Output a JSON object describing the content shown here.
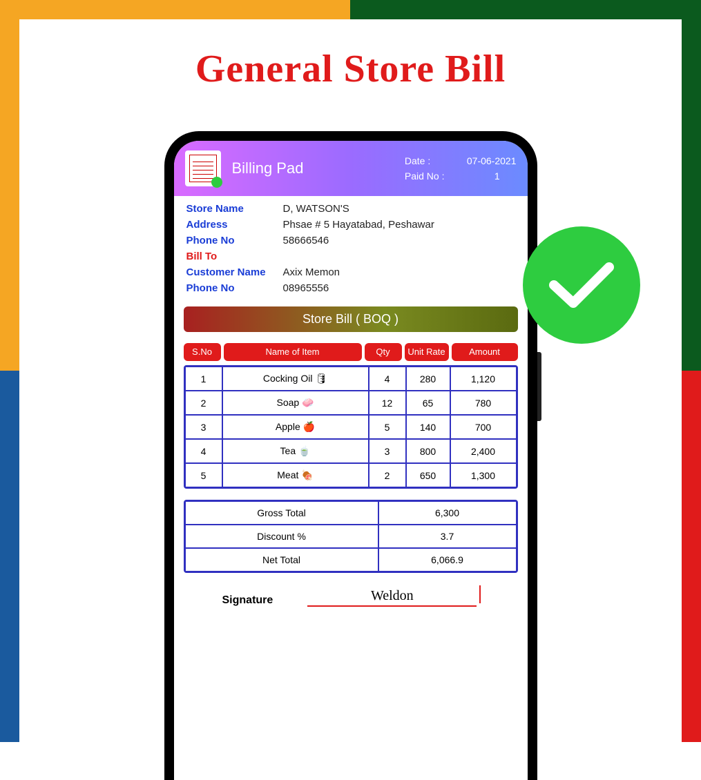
{
  "title": "General Store Bill",
  "header": {
    "app_title": "Billing Pad",
    "date_label": "Date :",
    "date_value": "07-06-2021",
    "paid_label": "Paid No :",
    "paid_value": "1"
  },
  "store": {
    "name_label": "Store Name",
    "name_value": "D, WATSON'S",
    "address_label": "Address",
    "address_value": "Phsae # 5 Hayatabad, Peshawar",
    "phone_label": "Phone No",
    "phone_value": "58666546"
  },
  "bill_to_label": "Bill To",
  "customer": {
    "name_label": "Customer Name",
    "name_value": "Axix Memon",
    "phone_label": "Phone No",
    "phone_value": "08965556"
  },
  "section_title": "Store Bill ( BOQ )",
  "columns": {
    "sno": "S.No",
    "name": "Name of Item",
    "qty": "Qty",
    "rate": "Unit Rate",
    "amount": "Amount"
  },
  "items": [
    {
      "sno": "1",
      "name": "Cocking Oil 🛢",
      "qty": "4",
      "rate": "280",
      "amount": "1,120"
    },
    {
      "sno": "2",
      "name": "Soap 🧼",
      "qty": "12",
      "rate": "65",
      "amount": "780"
    },
    {
      "sno": "3",
      "name": "Apple 🍎",
      "qty": "5",
      "rate": "140",
      "amount": "700"
    },
    {
      "sno": "4",
      "name": "Tea 🍵",
      "qty": "3",
      "rate": "800",
      "amount": "2,400"
    },
    {
      "sno": "5",
      "name": "Meat 🍖",
      "qty": "2",
      "rate": "650",
      "amount": "1,300"
    }
  ],
  "totals": {
    "gross_label": "Gross Total",
    "gross_value": "6,300",
    "discount_label": "Discount %",
    "discount_value": "3.7",
    "net_label": "Net Total",
    "net_value": "6,066.9"
  },
  "signature": {
    "label": "Signature",
    "value": "Weldon"
  }
}
